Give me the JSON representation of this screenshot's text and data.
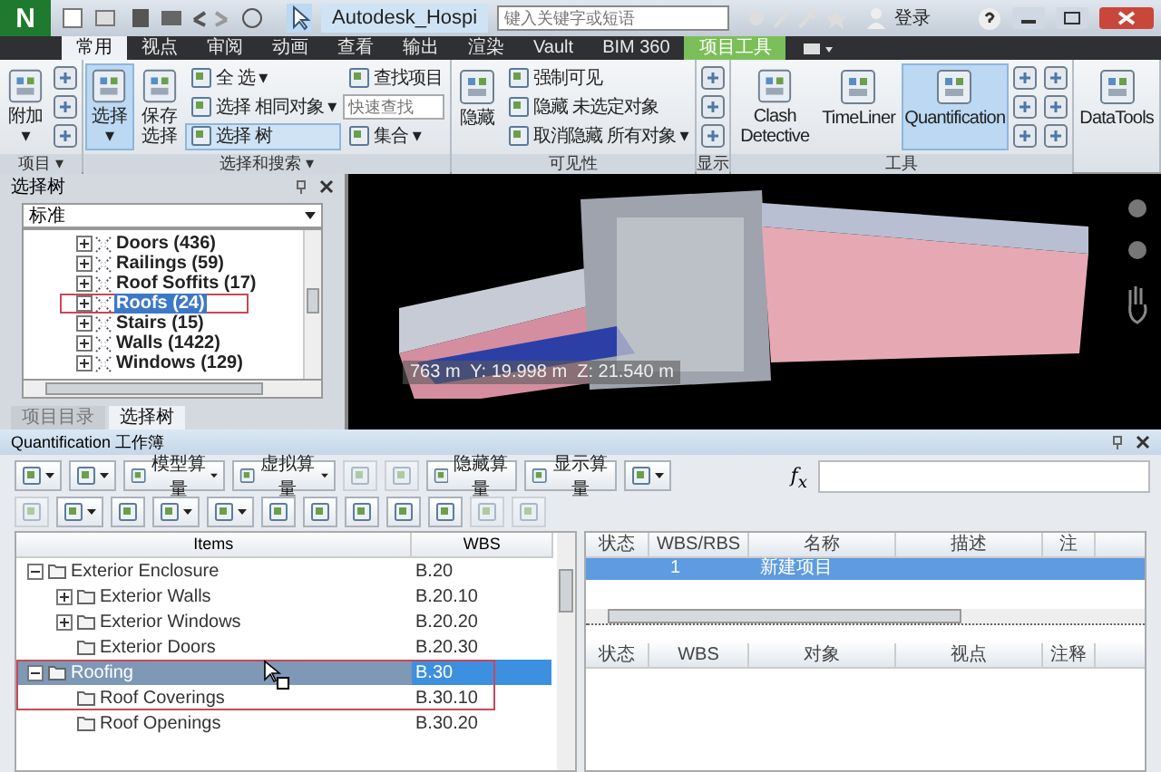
{
  "window": {
    "logo": "N",
    "title": "Autodesk_Hospi",
    "search_placeholder": "键入关键字或短语",
    "user": "登录"
  },
  "tabs": [
    {
      "label": "常用",
      "selected": true,
      "kind": "normal"
    },
    {
      "label": "视点",
      "selected": false,
      "kind": "normal"
    },
    {
      "label": "审阅",
      "selected": false,
      "kind": "normal"
    },
    {
      "label": "动画",
      "selected": false,
      "kind": "normal"
    },
    {
      "label": "查看",
      "selected": false,
      "kind": "normal"
    },
    {
      "label": "输出",
      "selected": false,
      "kind": "normal"
    },
    {
      "label": "渲染",
      "selected": false,
      "kind": "normal"
    },
    {
      "label": "Vault",
      "selected": false,
      "kind": "normal"
    },
    {
      "label": "BIM 360",
      "selected": false,
      "kind": "normal"
    },
    {
      "label": "项目工具",
      "selected": false,
      "kind": "contextual"
    }
  ],
  "ribbon": [
    {
      "title": "项目 ▾",
      "tools": [
        {
          "kind": "large",
          "label": "附加 ▾",
          "selected": false
        },
        {
          "kind": "icon"
        },
        {
          "kind": "icon"
        },
        {
          "kind": "icon"
        }
      ]
    },
    {
      "title": "选择和搜索 ▾",
      "tools": [
        {
          "kind": "large",
          "label": "选择 ▾",
          "selected": true
        },
        {
          "kind": "large",
          "label": "保存选择",
          "selected": false
        },
        {
          "kind": "small",
          "label": "全 选 ▾",
          "selected": false
        },
        {
          "kind": "small",
          "label": "选择 相同对象 ▾",
          "selected": false
        },
        {
          "kind": "small",
          "label": "选择 树",
          "selected": true
        },
        {
          "kind": "small",
          "label": "查找项目",
          "selected": false
        },
        {
          "kind": "field",
          "placeholder": "快速查找"
        },
        {
          "kind": "small",
          "label": "集合 ▾",
          "selected": false
        }
      ]
    },
    {
      "title": "可见性",
      "tools": [
        {
          "kind": "large",
          "label": "隐藏",
          "selected": false
        },
        {
          "kind": "small",
          "label": "强制可见",
          "selected": false
        },
        {
          "kind": "small",
          "label": "隐藏 未选定对象",
          "selected": false
        },
        {
          "kind": "small",
          "label": "取消隐藏 所有对象 ▾",
          "selected": false
        }
      ]
    },
    {
      "title": "显示",
      "tools": [
        {
          "kind": "icon"
        },
        {
          "kind": "icon"
        },
        {
          "kind": "icon"
        }
      ]
    },
    {
      "title": "工具",
      "tools": [
        {
          "kind": "large",
          "label": "Clash Detective",
          "selected": false
        },
        {
          "kind": "large",
          "label": "TimeLiner",
          "selected": false
        },
        {
          "kind": "large",
          "label": "Quantification",
          "selected": true
        },
        {
          "kind": "icon"
        },
        {
          "kind": "icon"
        },
        {
          "kind": "icon"
        },
        {
          "kind": "icon"
        },
        {
          "kind": "icon"
        },
        {
          "kind": "icon"
        }
      ]
    },
    {
      "tools": [
        {
          "kind": "large",
          "label": "DataTools",
          "selected": false
        }
      ]
    }
  ],
  "selection_tree": {
    "title": "选择树",
    "mode": "标准",
    "items": [
      {
        "label": "Doors (436)",
        "selected": false,
        "highlighted": false
      },
      {
        "label": "Railings (59)",
        "selected": false,
        "highlighted": false
      },
      {
        "label": "Roof Soffits (17)",
        "selected": false,
        "highlighted": false
      },
      {
        "label": "Roofs (24)",
        "selected": true,
        "highlighted": true
      },
      {
        "label": "Stairs (15)",
        "selected": false,
        "highlighted": false
      },
      {
        "label": "Walls (1422)",
        "selected": false,
        "highlighted": false
      },
      {
        "label": "Windows (129)",
        "selected": false,
        "highlighted": false
      }
    ],
    "tabs": [
      {
        "label": "项目目录",
        "selected": false
      },
      {
        "label": "选择树",
        "selected": true
      }
    ]
  },
  "viewport": {
    "readout": "763 m  Y: 19.998 m  Z: 21.540 m"
  },
  "quantification": {
    "title": "Quantification 工作簿",
    "toolbar": [
      [
        {
          "dropdown": true,
          "disabled": false
        },
        {
          "dropdown": true,
          "disabled": false
        },
        {
          "label": "模型算量",
          "dropdown": true,
          "disabled": false
        },
        {
          "label": "虚拟算量",
          "dropdown": true,
          "disabled": false
        },
        {
          "dropdown": false,
          "disabled": true
        },
        {
          "dropdown": false,
          "disabled": true
        },
        {
          "label": "隐藏算量",
          "dropdown": false,
          "disabled": false
        },
        {
          "label": "显示算量",
          "dropdown": false,
          "disabled": false
        },
        {
          "dropdown": true,
          "disabled": false
        }
      ],
      [
        {
          "dropdown": false,
          "disabled": true
        },
        {
          "dropdown": true,
          "disabled": false
        },
        {
          "dropdown": false,
          "disabled": false
        },
        {
          "dropdown": true,
          "disabled": false
        },
        {
          "dropdown": true,
          "disabled": false
        },
        {
          "dropdown": false,
          "disabled": false
        },
        {
          "dropdown": false,
          "disabled": false
        },
        {
          "dropdown": false,
          "disabled": false
        },
        {
          "dropdown": false,
          "disabled": false
        },
        {
          "dropdown": false,
          "disabled": false
        },
        {
          "dropdown": false,
          "disabled": true
        },
        {
          "dropdown": false,
          "disabled": true
        }
      ]
    ],
    "formula_label": "f$_{x}$",
    "items_table": {
      "columns": [
        "Items",
        "WBS"
      ],
      "rows": [
        {
          "label": "Exterior Enclosure",
          "wbs": "B.20",
          "kind": "group",
          "expanded": true,
          "selected": false,
          "highlighted": false,
          "children": [
            {
              "label": "Exterior Walls",
              "wbs": "B.20.10",
              "kind": "group",
              "expanded": false,
              "selected": false,
              "highlighted": false
            },
            {
              "label": "Exterior Windows",
              "wbs": "B.20.20",
              "kind": "group",
              "expanded": false,
              "selected": false,
              "highlighted": false
            },
            {
              "label": "Exterior Doors",
              "wbs": "B.20.30",
              "kind": "leaf",
              "selected": false,
              "highlighted": false
            }
          ]
        },
        {
          "label": "Roofing",
          "wbs": "B.30",
          "kind": "group",
          "expanded": true,
          "selected": true,
          "highlighted": true,
          "children": [
            {
              "label": "Roof Coverings",
              "wbs": "B.30.10",
              "kind": "leaf",
              "selected": false,
              "highlighted": true
            },
            {
              "label": "Roof Openings",
              "wbs": "B.30.20",
              "kind": "leaf",
              "selected": false,
              "highlighted": false
            }
          ]
        }
      ]
    },
    "resource_table": {
      "columns": [
        "状态",
        "WBS/RBS",
        "名称",
        "描述",
        "注"
      ],
      "rows": [
        {
          "wbs_rbs": "1",
          "name": "新建项目",
          "selected": true
        }
      ]
    },
    "object_table": {
      "columns": [
        "状态",
        "WBS",
        "对象",
        "视点",
        "注释"
      ]
    }
  }
}
